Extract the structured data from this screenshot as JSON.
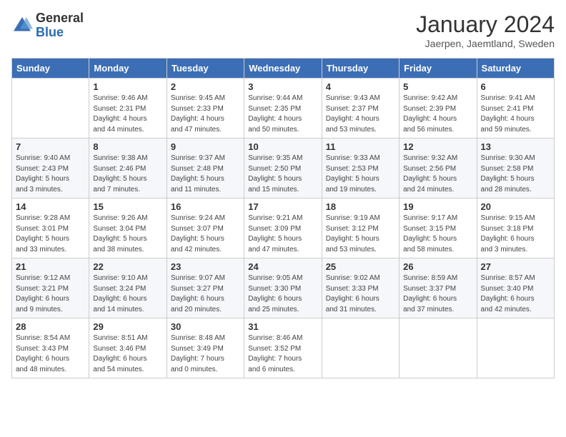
{
  "header": {
    "logo_general": "General",
    "logo_blue": "Blue",
    "month_title": "January 2024",
    "subtitle": "Jaerpen, Jaemtland, Sweden"
  },
  "weekdays": [
    "Sunday",
    "Monday",
    "Tuesday",
    "Wednesday",
    "Thursday",
    "Friday",
    "Saturday"
  ],
  "weeks": [
    [
      {
        "day": "",
        "info": ""
      },
      {
        "day": "1",
        "info": "Sunrise: 9:46 AM\nSunset: 2:31 PM\nDaylight: 4 hours\nand 44 minutes."
      },
      {
        "day": "2",
        "info": "Sunrise: 9:45 AM\nSunset: 2:33 PM\nDaylight: 4 hours\nand 47 minutes."
      },
      {
        "day": "3",
        "info": "Sunrise: 9:44 AM\nSunset: 2:35 PM\nDaylight: 4 hours\nand 50 minutes."
      },
      {
        "day": "4",
        "info": "Sunrise: 9:43 AM\nSunset: 2:37 PM\nDaylight: 4 hours\nand 53 minutes."
      },
      {
        "day": "5",
        "info": "Sunrise: 9:42 AM\nSunset: 2:39 PM\nDaylight: 4 hours\nand 56 minutes."
      },
      {
        "day": "6",
        "info": "Sunrise: 9:41 AM\nSunset: 2:41 PM\nDaylight: 4 hours\nand 59 minutes."
      }
    ],
    [
      {
        "day": "7",
        "info": "Sunrise: 9:40 AM\nSunset: 2:43 PM\nDaylight: 5 hours\nand 3 minutes."
      },
      {
        "day": "8",
        "info": "Sunrise: 9:38 AM\nSunset: 2:46 PM\nDaylight: 5 hours\nand 7 minutes."
      },
      {
        "day": "9",
        "info": "Sunrise: 9:37 AM\nSunset: 2:48 PM\nDaylight: 5 hours\nand 11 minutes."
      },
      {
        "day": "10",
        "info": "Sunrise: 9:35 AM\nSunset: 2:50 PM\nDaylight: 5 hours\nand 15 minutes."
      },
      {
        "day": "11",
        "info": "Sunrise: 9:33 AM\nSunset: 2:53 PM\nDaylight: 5 hours\nand 19 minutes."
      },
      {
        "day": "12",
        "info": "Sunrise: 9:32 AM\nSunset: 2:56 PM\nDaylight: 5 hours\nand 24 minutes."
      },
      {
        "day": "13",
        "info": "Sunrise: 9:30 AM\nSunset: 2:58 PM\nDaylight: 5 hours\nand 28 minutes."
      }
    ],
    [
      {
        "day": "14",
        "info": "Sunrise: 9:28 AM\nSunset: 3:01 PM\nDaylight: 5 hours\nand 33 minutes."
      },
      {
        "day": "15",
        "info": "Sunrise: 9:26 AM\nSunset: 3:04 PM\nDaylight: 5 hours\nand 38 minutes."
      },
      {
        "day": "16",
        "info": "Sunrise: 9:24 AM\nSunset: 3:07 PM\nDaylight: 5 hours\nand 42 minutes."
      },
      {
        "day": "17",
        "info": "Sunrise: 9:21 AM\nSunset: 3:09 PM\nDaylight: 5 hours\nand 47 minutes."
      },
      {
        "day": "18",
        "info": "Sunrise: 9:19 AM\nSunset: 3:12 PM\nDaylight: 5 hours\nand 53 minutes."
      },
      {
        "day": "19",
        "info": "Sunrise: 9:17 AM\nSunset: 3:15 PM\nDaylight: 5 hours\nand 58 minutes."
      },
      {
        "day": "20",
        "info": "Sunrise: 9:15 AM\nSunset: 3:18 PM\nDaylight: 6 hours\nand 3 minutes."
      }
    ],
    [
      {
        "day": "21",
        "info": "Sunrise: 9:12 AM\nSunset: 3:21 PM\nDaylight: 6 hours\nand 9 minutes."
      },
      {
        "day": "22",
        "info": "Sunrise: 9:10 AM\nSunset: 3:24 PM\nDaylight: 6 hours\nand 14 minutes."
      },
      {
        "day": "23",
        "info": "Sunrise: 9:07 AM\nSunset: 3:27 PM\nDaylight: 6 hours\nand 20 minutes."
      },
      {
        "day": "24",
        "info": "Sunrise: 9:05 AM\nSunset: 3:30 PM\nDaylight: 6 hours\nand 25 minutes."
      },
      {
        "day": "25",
        "info": "Sunrise: 9:02 AM\nSunset: 3:33 PM\nDaylight: 6 hours\nand 31 minutes."
      },
      {
        "day": "26",
        "info": "Sunrise: 8:59 AM\nSunset: 3:37 PM\nDaylight: 6 hours\nand 37 minutes."
      },
      {
        "day": "27",
        "info": "Sunrise: 8:57 AM\nSunset: 3:40 PM\nDaylight: 6 hours\nand 42 minutes."
      }
    ],
    [
      {
        "day": "28",
        "info": "Sunrise: 8:54 AM\nSunset: 3:43 PM\nDaylight: 6 hours\nand 48 minutes."
      },
      {
        "day": "29",
        "info": "Sunrise: 8:51 AM\nSunset: 3:46 PM\nDaylight: 6 hours\nand 54 minutes."
      },
      {
        "day": "30",
        "info": "Sunrise: 8:48 AM\nSunset: 3:49 PM\nDaylight: 7 hours\nand 0 minutes."
      },
      {
        "day": "31",
        "info": "Sunrise: 8:46 AM\nSunset: 3:52 PM\nDaylight: 7 hours\nand 6 minutes."
      },
      {
        "day": "",
        "info": ""
      },
      {
        "day": "",
        "info": ""
      },
      {
        "day": "",
        "info": ""
      }
    ]
  ]
}
